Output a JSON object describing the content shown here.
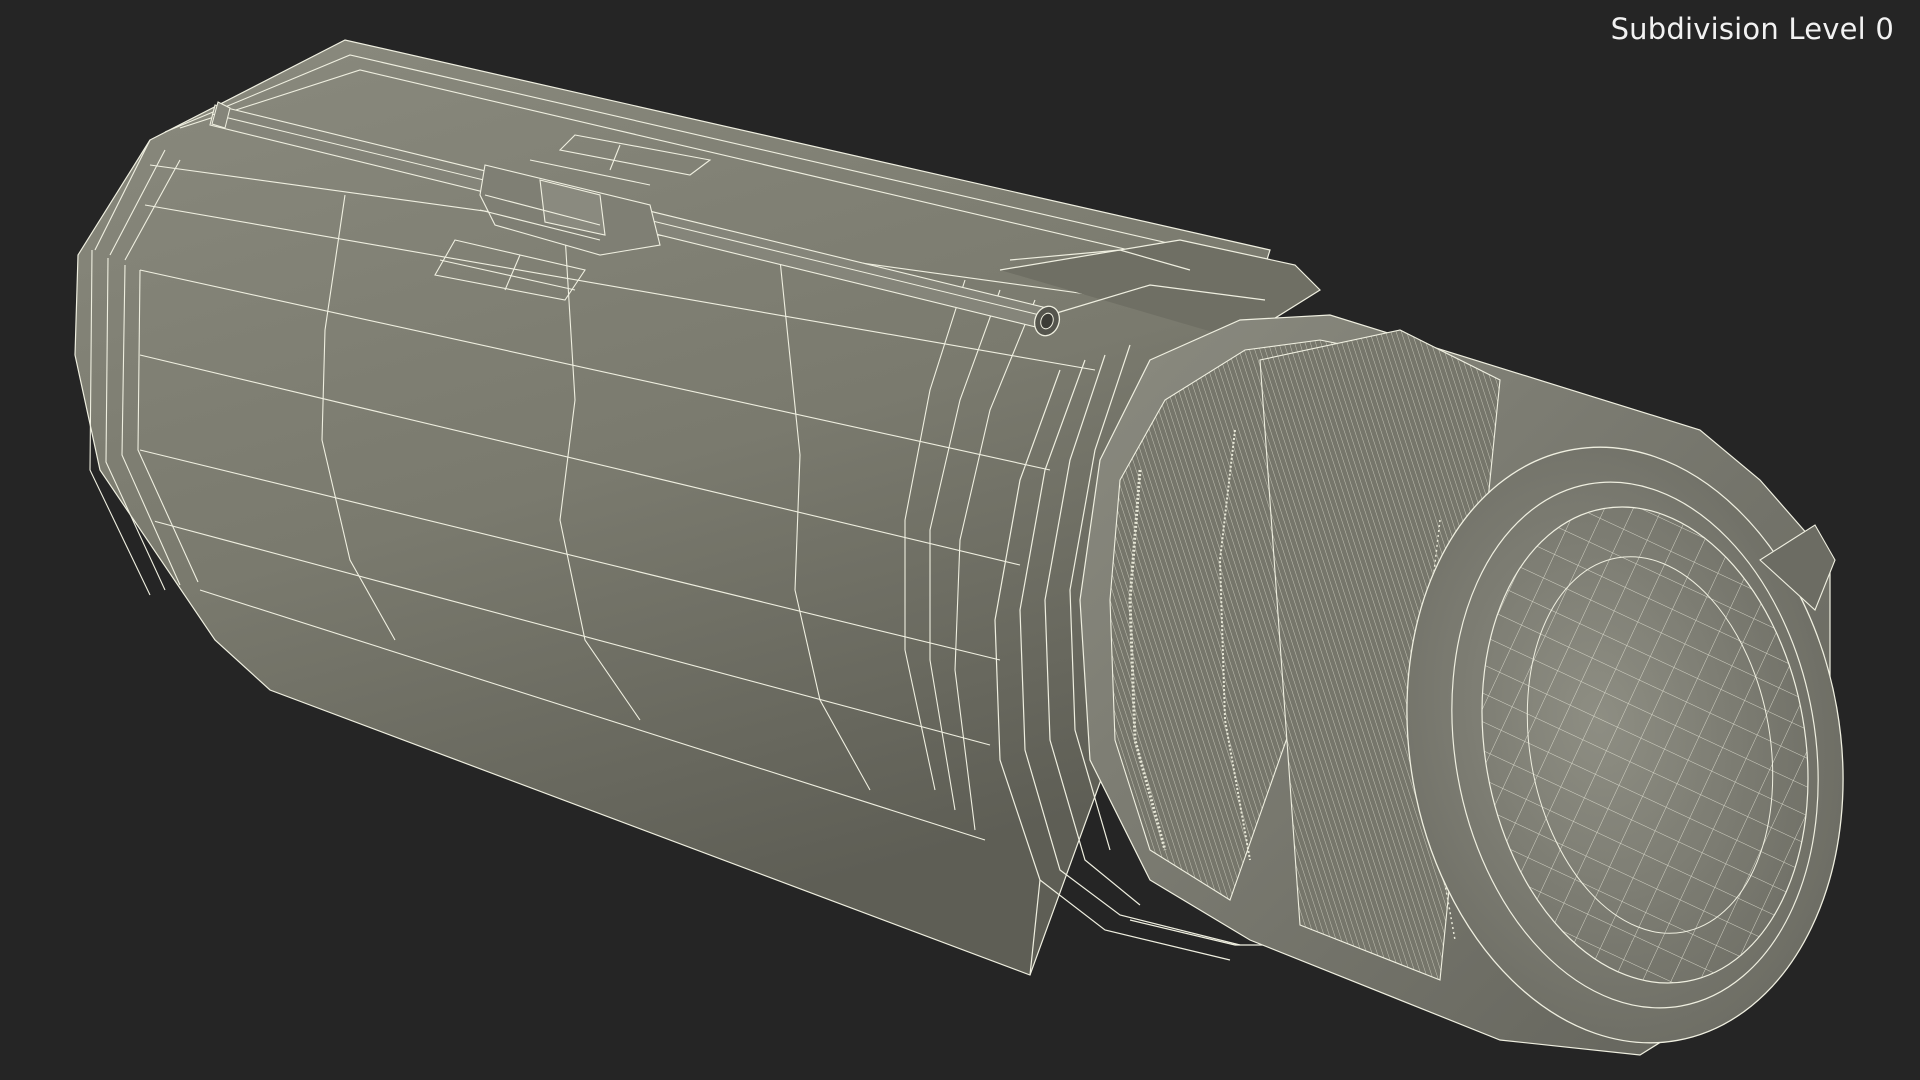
{
  "viewport": {
    "label": "Subdivision Level 0",
    "background": "#252525",
    "surface_color": "#7d7d71",
    "shadow_color": "#4d4d45",
    "wire_color": "#efefe0",
    "model_parts": [
      "main-cylinder-body",
      "pipe-rod",
      "clamp-bracket",
      "flange-ring",
      "knurled-cap",
      "end-face"
    ]
  }
}
